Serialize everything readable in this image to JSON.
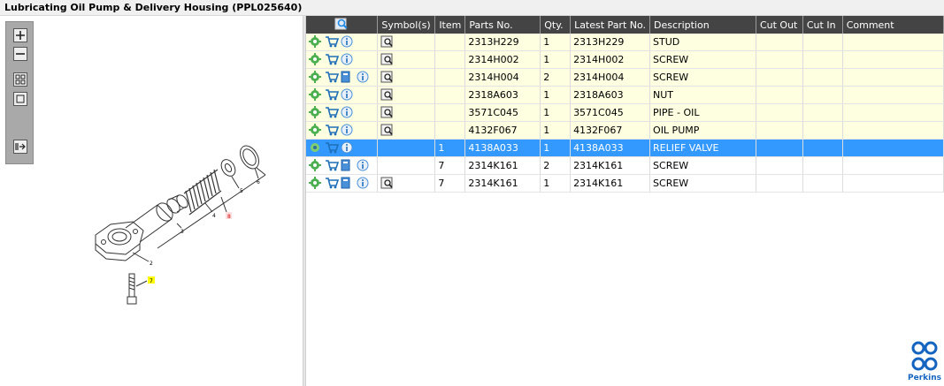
{
  "window": {
    "title": "Lubricating Oil Pump & Delivery Housing (PPL025640)"
  },
  "drawing": {
    "callouts": [
      "2",
      "3",
      "4",
      "5",
      "6",
      "7",
      "8"
    ],
    "highlight_color": "#ffff00"
  },
  "zoom_toolbar": {
    "tools": [
      "zoom-in-icon",
      "zoom-out-icon",
      "fit-all-icon",
      "fit-window-icon",
      "export-icon"
    ]
  },
  "grid": {
    "columns": [
      "",
      "Symbol(s)",
      "Item",
      "Parts No.",
      "Qty.",
      "Latest Part No.",
      "Description",
      "Cut Out",
      "Cut In",
      "Comment"
    ],
    "rows": [
      {
        "item": "",
        "parts_no": "2313H229",
        "qty": "1",
        "latest": "2313H229",
        "description": "STUD",
        "cut_out": "",
        "cut_in": "",
        "comment": "",
        "doc_icon": false,
        "symbol_icon": true,
        "style": "yellow"
      },
      {
        "item": "",
        "parts_no": "2314H002",
        "qty": "1",
        "latest": "2314H002",
        "description": "SCREW",
        "cut_out": "",
        "cut_in": "",
        "comment": "",
        "doc_icon": false,
        "symbol_icon": true,
        "style": "yellow"
      },
      {
        "item": "",
        "parts_no": "2314H004",
        "qty": "2",
        "latest": "2314H004",
        "description": "SCREW",
        "cut_out": "",
        "cut_in": "",
        "comment": "",
        "doc_icon": true,
        "symbol_icon": true,
        "style": "yellow"
      },
      {
        "item": "",
        "parts_no": "2318A603",
        "qty": "1",
        "latest": "2318A603",
        "description": "NUT",
        "cut_out": "",
        "cut_in": "",
        "comment": "",
        "doc_icon": false,
        "symbol_icon": true,
        "style": "yellow"
      },
      {
        "item": "",
        "parts_no": "3571C045",
        "qty": "1",
        "latest": "3571C045",
        "description": "PIPE - OIL",
        "cut_out": "",
        "cut_in": "",
        "comment": "",
        "doc_icon": false,
        "symbol_icon": true,
        "style": "yellow"
      },
      {
        "item": "",
        "parts_no": "4132F067",
        "qty": "1",
        "latest": "4132F067",
        "description": "OIL PUMP",
        "cut_out": "",
        "cut_in": "",
        "comment": "",
        "doc_icon": false,
        "symbol_icon": true,
        "style": "yellow"
      },
      {
        "item": "1",
        "parts_no": "4138A033",
        "qty": "1",
        "latest": "4138A033",
        "description": "RELIEF VALVE",
        "cut_out": "",
        "cut_in": "",
        "comment": "",
        "doc_icon": false,
        "symbol_icon": false,
        "style": "selected"
      },
      {
        "item": "7",
        "parts_no": "2314K161",
        "qty": "2",
        "latest": "2314K161",
        "description": "SCREW",
        "cut_out": "",
        "cut_in": "",
        "comment": "",
        "doc_icon": true,
        "symbol_icon": false,
        "style": "white"
      },
      {
        "item": "7",
        "parts_no": "2314K161",
        "qty": "1",
        "latest": "2314K161",
        "description": "SCREW",
        "cut_out": "",
        "cut_in": "",
        "comment": "",
        "doc_icon": true,
        "symbol_icon": true,
        "style": "white"
      }
    ]
  },
  "brand": {
    "name": "Perkins",
    "color": "#1565c0"
  },
  "colors": {
    "selection": "#3399ff",
    "header_bg": "#444444",
    "row_highlight": "#fefee0"
  }
}
